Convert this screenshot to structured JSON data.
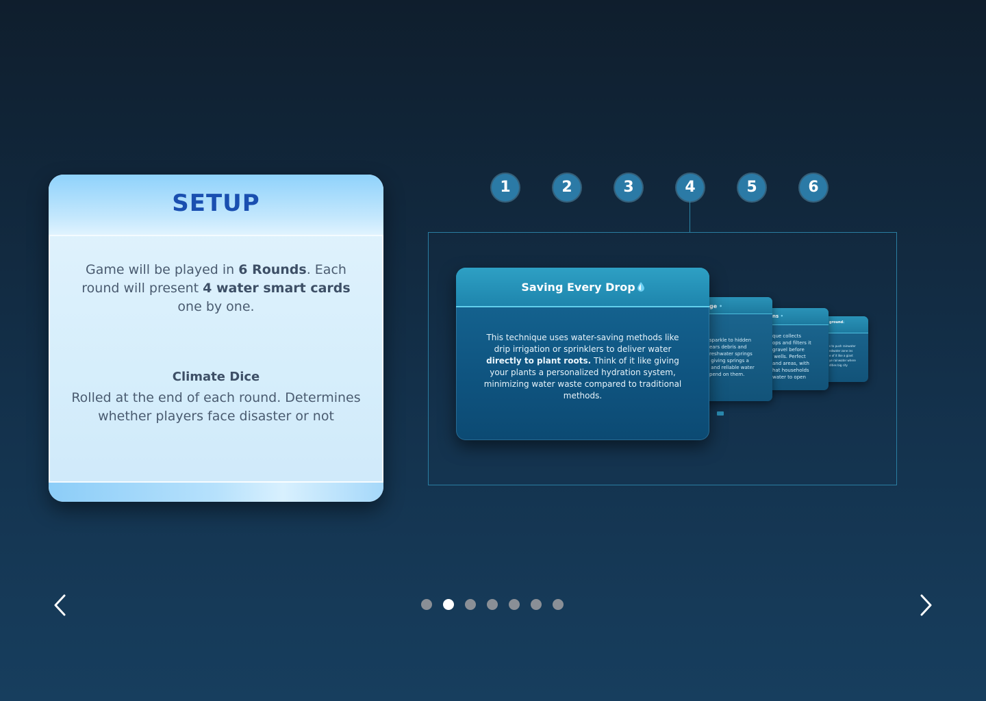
{
  "setup": {
    "title": "SETUP",
    "para1": [
      {
        "t": "Game will be played in ",
        "b": false
      },
      {
        "t": "6 Rounds",
        "b": true
      },
      {
        "t": ". Each round will present ",
        "b": false
      },
      {
        "t": "4 water smart cards",
        "b": true
      },
      {
        "t": " one by one.",
        "b": false
      }
    ],
    "dice_title": "Climate Dice",
    "para2": "Rolled at the end of each round. Determines whether players face disaster or not"
  },
  "rounds": [
    "1",
    "2",
    "3",
    "4",
    "5",
    "6"
  ],
  "active_round": "4",
  "front_card": {
    "title": "Saving Every Drop",
    "title_icon": "water-drop-icon",
    "body": [
      {
        "t": "This technique uses water-saving methods like drip irrigation or sprinklers to deliver water ",
        "b": false
      },
      {
        "t": "directly to plant roots.",
        "b": true
      },
      {
        "t": " Think of it like giving your plants a personalized hydration system, minimizing water waste compared to traditional methods.",
        "b": false
      }
    ]
  },
  "back_cards": [
    {
      "title": "ge",
      "icon": "water-drop-icon",
      "body": "sparkle to hidden\nears debris and\nreshwater springs\n giving springs a\n and reliable water\npend on them."
    },
    {
      "title": "ns",
      "icon": "water-drop-icon",
      "body": "que collects\nops and filters it\ngravel before\n wells. Perfect\nand areas, with\nhat households\nwater to open"
    },
    {
      "title": "ground",
      "icon": "water-drop-icon",
      "body": "s to push rainwater\nndwater zone ins\ne of it like a giant\nye rainwater where\ndities big city"
    }
  ],
  "navigation": {
    "prev_icon": "chevron-left-icon",
    "next_icon": "chevron-right-icon",
    "slide_count": 7,
    "active_slide": 2
  },
  "colors": {
    "accent": "#2b7aa6",
    "setup_title": "#1a4fb0",
    "card_blue": "#0f5581"
  }
}
